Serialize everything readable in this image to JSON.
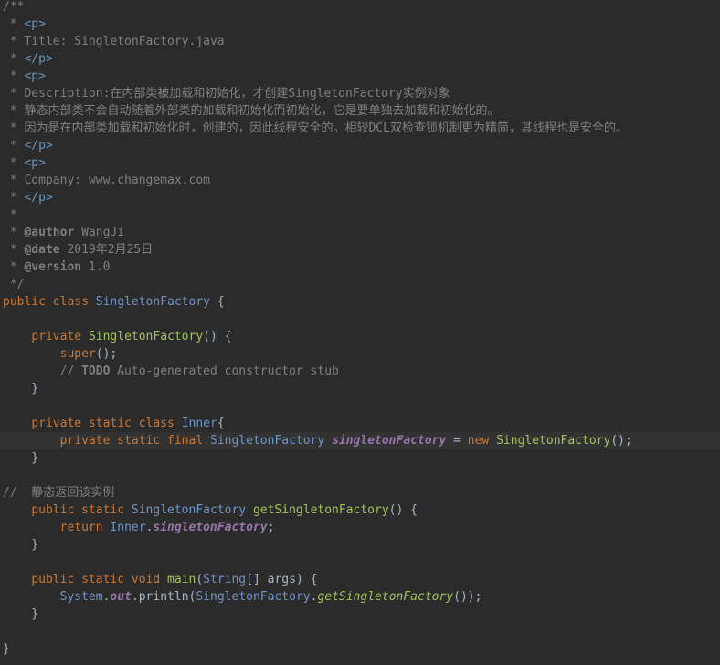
{
  "editor": {
    "lines": [
      [
        {
          "t": "/**",
          "c": "comment"
        }
      ],
      [
        {
          "t": " * ",
          "c": "comment"
        },
        {
          "t": "<p>",
          "c": "tag"
        }
      ],
      [
        {
          "t": " * Title: SingletonFactory.java",
          "c": "comment"
        }
      ],
      [
        {
          "t": " * ",
          "c": "comment"
        },
        {
          "t": "</p>",
          "c": "tag"
        }
      ],
      [
        {
          "t": " * ",
          "c": "comment"
        },
        {
          "t": "<p>",
          "c": "tag"
        }
      ],
      [
        {
          "t": " * Description:在内部类被加载和初始化，才创建SingletonFactory实例对象",
          "c": "comment"
        }
      ],
      [
        {
          "t": " * 静态内部类不会自动随着外部类的加载和初始化而初始化，它是要单独去加载和初始化的。",
          "c": "comment"
        }
      ],
      [
        {
          "t": " * 因为是在内部类加载和初始化时，创建的，因此线程安全的。相较DCL双检查锁机制更为精简，其线程也是安全的。",
          "c": "comment"
        }
      ],
      [
        {
          "t": " * ",
          "c": "comment"
        },
        {
          "t": "</p>",
          "c": "tag"
        }
      ],
      [
        {
          "t": " * ",
          "c": "comment"
        },
        {
          "t": "<p>",
          "c": "tag"
        }
      ],
      [
        {
          "t": " * Company: www.changemax.com",
          "c": "comment"
        }
      ],
      [
        {
          "t": " * ",
          "c": "comment"
        },
        {
          "t": "</p>",
          "c": "tag"
        }
      ],
      [
        {
          "t": " *",
          "c": "comment"
        }
      ],
      [
        {
          "t": " * ",
          "c": "comment"
        },
        {
          "t": "@author",
          "c": "tb"
        },
        {
          "t": " WangJi",
          "c": "comment"
        }
      ],
      [
        {
          "t": " * ",
          "c": "comment"
        },
        {
          "t": "@date",
          "c": "tb"
        },
        {
          "t": " 2019年2月25日",
          "c": "comment"
        }
      ],
      [
        {
          "t": " * ",
          "c": "comment"
        },
        {
          "t": "@version",
          "c": "tb"
        },
        {
          "t": " 1.0",
          "c": "comment"
        }
      ],
      [
        {
          "t": " */",
          "c": "comment"
        }
      ],
      [
        {
          "t": "public class ",
          "c": "kw"
        },
        {
          "t": "SingletonFactory",
          "c": "type"
        },
        {
          "t": " {",
          "c": "plain"
        }
      ],
      [],
      [
        {
          "t": "    ",
          "c": "plain"
        },
        {
          "t": "private ",
          "c": "kw"
        },
        {
          "t": "SingletonFactory",
          "c": "method"
        },
        {
          "t": "() {",
          "c": "plain"
        }
      ],
      [
        {
          "t": "        ",
          "c": "plain"
        },
        {
          "t": "super",
          "c": "kw"
        },
        {
          "t": "();",
          "c": "plain"
        }
      ],
      [
        {
          "t": "        // ",
          "c": "comment"
        },
        {
          "t": "TODO",
          "c": "tb"
        },
        {
          "t": " Auto-generated constructor stub",
          "c": "comment"
        }
      ],
      [
        {
          "t": "    }",
          "c": "plain"
        }
      ],
      [],
      [
        {
          "t": "    ",
          "c": "plain"
        },
        {
          "t": "private static class ",
          "c": "kw"
        },
        {
          "t": "Inner",
          "c": "type"
        },
        {
          "t": "{",
          "c": "plain"
        }
      ],
      [
        {
          "t": "        ",
          "c": "plain"
        },
        {
          "t": "private static final ",
          "c": "kw"
        },
        {
          "t": "SingletonFactory ",
          "c": "type"
        },
        {
          "t": "singletonFactory",
          "c": "field"
        },
        {
          "t": " = ",
          "c": "plain"
        },
        {
          "t": "new ",
          "c": "kw"
        },
        {
          "t": "SingletonFactory",
          "c": "method"
        },
        {
          "t": "();",
          "c": "plain"
        }
      ],
      [
        {
          "t": "    }",
          "c": "plain"
        }
      ],
      [],
      [
        {
          "t": "//  静态返回该实例",
          "c": "comment"
        }
      ],
      [
        {
          "t": "    ",
          "c": "plain"
        },
        {
          "t": "public static ",
          "c": "kw"
        },
        {
          "t": "SingletonFactory ",
          "c": "type"
        },
        {
          "t": "getSingletonFactory",
          "c": "method"
        },
        {
          "t": "() {",
          "c": "plain"
        }
      ],
      [
        {
          "t": "        ",
          "c": "plain"
        },
        {
          "t": "return ",
          "c": "kw"
        },
        {
          "t": "Inner",
          "c": "type"
        },
        {
          "t": ".",
          "c": "plain"
        },
        {
          "t": "singletonFactory",
          "c": "field"
        },
        {
          "t": ";",
          "c": "plain"
        }
      ],
      [
        {
          "t": "    }",
          "c": "plain"
        }
      ],
      [],
      [
        {
          "t": "    ",
          "c": "plain"
        },
        {
          "t": "public static void ",
          "c": "kw"
        },
        {
          "t": "main",
          "c": "method"
        },
        {
          "t": "(",
          "c": "plain"
        },
        {
          "t": "String",
          "c": "type"
        },
        {
          "t": "[] ",
          "c": "plain"
        },
        {
          "t": "args",
          "c": "param"
        },
        {
          "t": ") {",
          "c": "plain"
        }
      ],
      [
        {
          "t": "        ",
          "c": "plain"
        },
        {
          "t": "System",
          "c": "type"
        },
        {
          "t": ".",
          "c": "plain"
        },
        {
          "t": "out",
          "c": "field"
        },
        {
          "t": ".println(",
          "c": "plain"
        },
        {
          "t": "SingletonFactory",
          "c": "type"
        },
        {
          "t": ".",
          "c": "plain"
        },
        {
          "t": "getSingletonFactory",
          "c": "staticm"
        },
        {
          "t": "());",
          "c": "plain"
        }
      ],
      [
        {
          "t": "    }",
          "c": "plain"
        }
      ],
      [],
      [
        {
          "t": "}",
          "c": "plain"
        }
      ]
    ],
    "highlighted_line": 25
  }
}
